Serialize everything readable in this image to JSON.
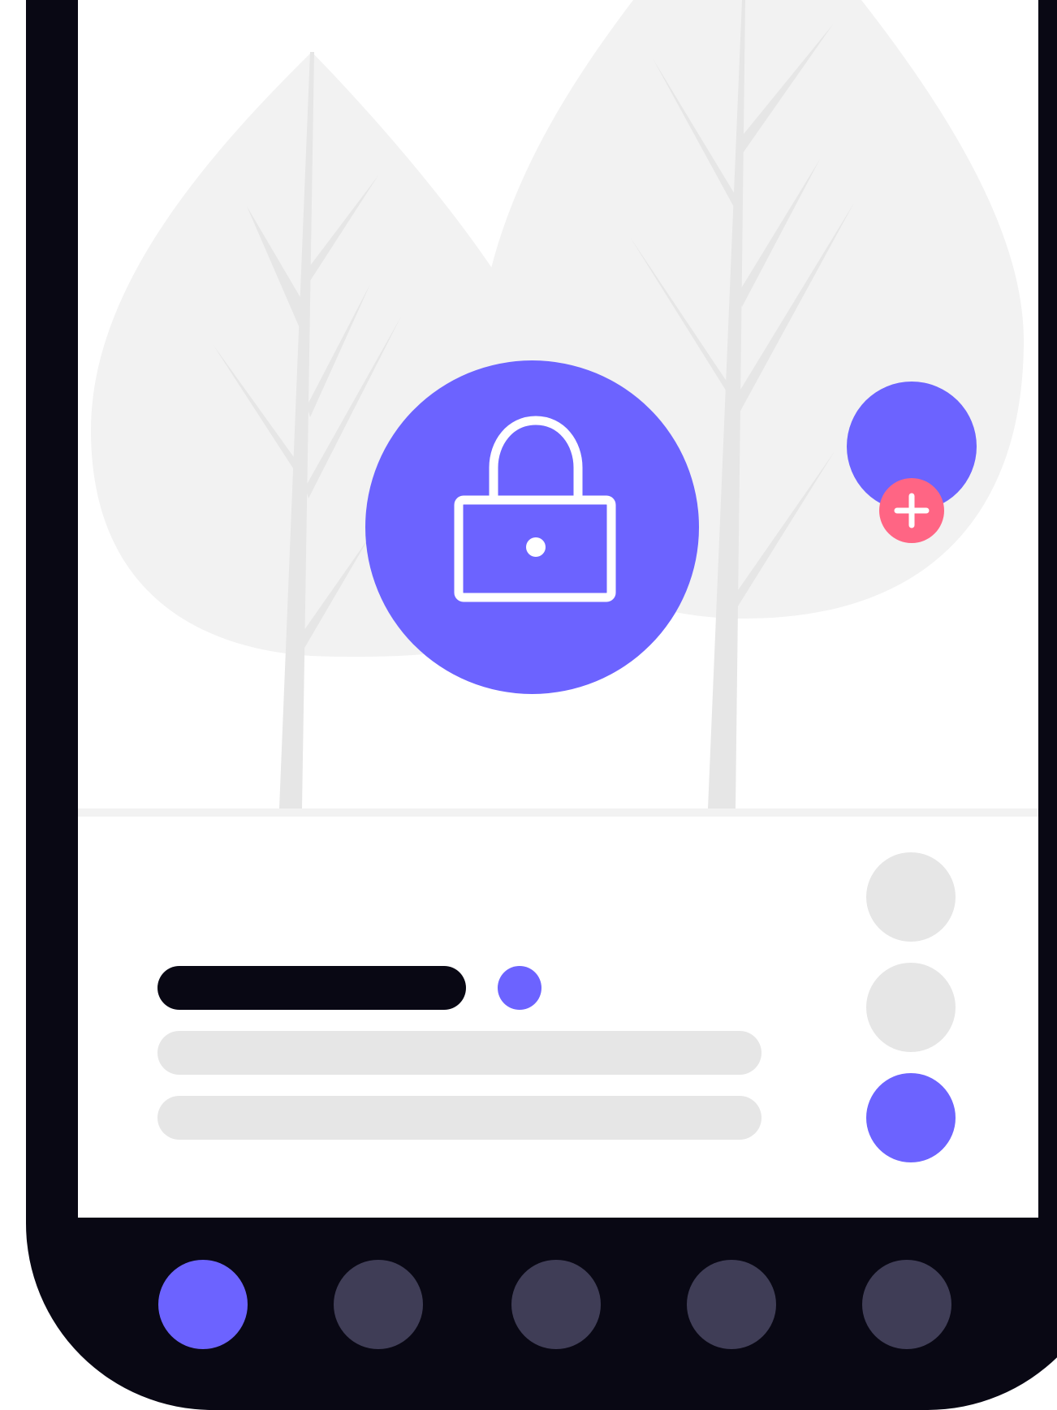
{
  "colors": {
    "frame": "#090814",
    "screen": "#ffffff",
    "accent": "#6c63ff",
    "notification": "#ff6584",
    "placeholder": "#e6e6e6",
    "tree_canopy": "#f2f2f2",
    "nav_inactive": "#3f3d56"
  },
  "illustration": {
    "icons": [
      "tree-icon",
      "tree-icon",
      "lock-icon",
      "plus-icon"
    ]
  },
  "content": {
    "title_placeholder": "",
    "status_dot_active": true,
    "lines": 2
  },
  "options": [
    {
      "icon": "circle-option",
      "active": false
    },
    {
      "icon": "circle-option",
      "active": false
    },
    {
      "icon": "circle-option",
      "active": true
    }
  ],
  "nav": {
    "items": [
      {
        "icon": "nav-circle-icon",
        "active": true
      },
      {
        "icon": "nav-circle-icon",
        "active": false
      },
      {
        "icon": "nav-circle-icon",
        "active": false
      },
      {
        "icon": "nav-circle-icon",
        "active": false
      },
      {
        "icon": "nav-circle-icon",
        "active": false
      }
    ]
  }
}
